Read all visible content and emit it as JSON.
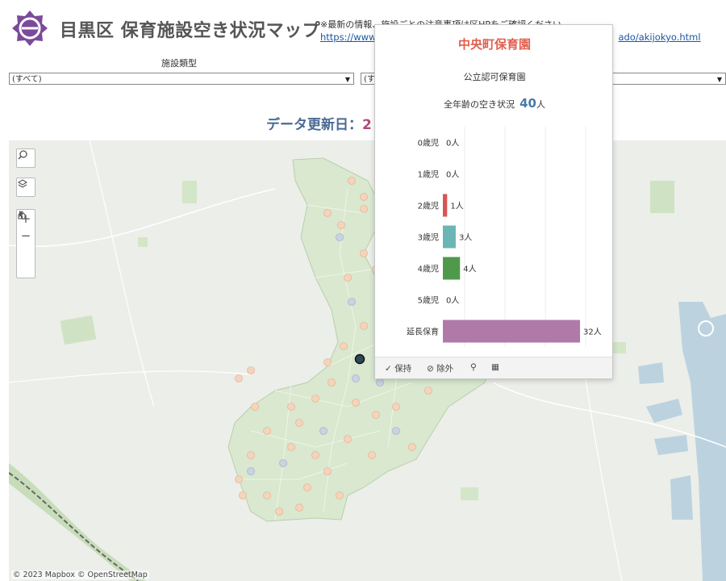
{
  "header": {
    "title": "目黒区 保育施設空き状況マップ",
    "notice": "※最新の情報、施設ごとの注意事項は区HPをご確認ください",
    "url_start": "https://www",
    "url_end": "ado/akijokyo.html"
  },
  "filters": {
    "label": "施設類型",
    "first_value": "(すべて)",
    "second_value": "(す",
    "third_value": ""
  },
  "update": {
    "label": "データ更新日：",
    "value": "2"
  },
  "map": {
    "attribution": "© 2023 Mapbox  © OpenStreetMap",
    "controls": {
      "search": "search-icon",
      "layers": "layers-icon",
      "zoom_in": "+",
      "zoom_out": "−",
      "home": "home-icon",
      "play": "play-icon"
    }
  },
  "tooltip": {
    "facility_name": "中央町保育園",
    "facility_type": "公立認可保育園",
    "total_label": "全年齢の空き状況",
    "total_value": "40",
    "total_unit": "人",
    "colors": {
      "title": "#e0604f",
      "age2": "#d95555",
      "age3": "#6bb5b5",
      "age4": "#4f9a4a",
      "extended": "#b07aa8"
    },
    "actions": {
      "keep": "保持",
      "exclude": "除外"
    }
  },
  "chart_data": {
    "type": "bar",
    "orientation": "horizontal",
    "categories": [
      "0歳児",
      "1歳児",
      "2歳児",
      "3歳児",
      "4歳児",
      "5歳児",
      "延長保育"
    ],
    "values": [
      0,
      0,
      1,
      3,
      4,
      0,
      32
    ],
    "value_labels": [
      "0人",
      "0人",
      "1人",
      "3人",
      "4人",
      "0人",
      "32人"
    ],
    "colors": [
      "#999999",
      "#999999",
      "#d95555",
      "#6bb5b5",
      "#4f9a4a",
      "#999999",
      "#b07aa8"
    ],
    "xlim": [
      0,
      35
    ]
  }
}
